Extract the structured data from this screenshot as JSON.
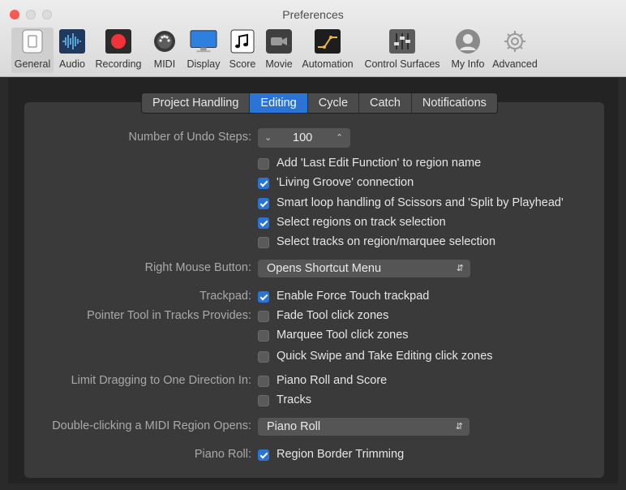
{
  "window": {
    "title": "Preferences"
  },
  "toolbar": {
    "items": [
      {
        "label": "General",
        "icon": "general-switch-icon"
      },
      {
        "label": "Audio",
        "icon": "audio-waveform-icon"
      },
      {
        "label": "Recording",
        "icon": "record-icon"
      },
      {
        "label": "MIDI",
        "icon": "midi-connector-icon"
      },
      {
        "label": "Display",
        "icon": "display-monitor-icon"
      },
      {
        "label": "Score",
        "icon": "score-notes-icon"
      },
      {
        "label": "Movie",
        "icon": "movie-camera-icon"
      },
      {
        "label": "Automation",
        "icon": "automation-curve-icon"
      },
      {
        "label": "Control Surfaces",
        "icon": "control-surfaces-faders-icon"
      },
      {
        "label": "My Info",
        "icon": "user-silhouette-icon"
      },
      {
        "label": "Advanced",
        "icon": "gear-icon"
      }
    ],
    "selected": "General"
  },
  "tabs": [
    {
      "label": "Project Handling",
      "active": false
    },
    {
      "label": "Editing",
      "active": true
    },
    {
      "label": "Cycle",
      "active": false
    },
    {
      "label": "Catch",
      "active": false
    },
    {
      "label": "Notifications",
      "active": false
    }
  ],
  "undo": {
    "label": "Number of Undo Steps:",
    "value": "100"
  },
  "region_options": [
    {
      "label": "Add 'Last Edit Function' to region name",
      "checked": false
    },
    {
      "label": "'Living Groove' connection",
      "checked": true
    },
    {
      "label": "Smart loop handling of Scissors and 'Split by Playhead'",
      "checked": true
    },
    {
      "label": "Select regions on track selection",
      "checked": true
    },
    {
      "label": "Select tracks on region/marquee selection",
      "checked": false
    }
  ],
  "right_mouse": {
    "label": "Right Mouse Button:",
    "value": "Opens Shortcut Menu"
  },
  "trackpad": {
    "label": "Trackpad:",
    "option": "Enable Force Touch trackpad",
    "checked": true
  },
  "pointer_tool": {
    "label": "Pointer Tool in Tracks Provides:",
    "options": [
      {
        "label": "Fade Tool click zones",
        "checked": false
      },
      {
        "label": "Marquee Tool click zones",
        "checked": false
      },
      {
        "label": "Quick Swipe and Take Editing click zones",
        "checked": false
      }
    ]
  },
  "limit_drag": {
    "label": "Limit Dragging to One Direction In:",
    "options": [
      {
        "label": "Piano Roll and Score",
        "checked": false
      },
      {
        "label": "Tracks",
        "checked": false
      }
    ]
  },
  "double_click": {
    "label": "Double-clicking a MIDI Region Opens:",
    "value": "Piano Roll"
  },
  "piano_roll": {
    "label": "Piano Roll:",
    "option": "Region Border Trimming",
    "checked": true
  },
  "colors": {
    "accent": "#2a74d6",
    "panel": "#3a3a3a",
    "background": "#232323"
  }
}
